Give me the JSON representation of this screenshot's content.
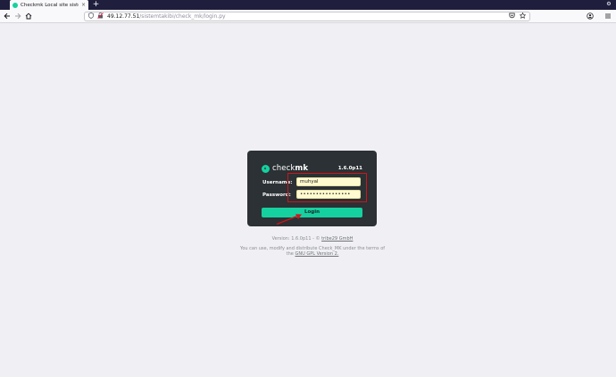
{
  "browser": {
    "tab_title": "Checkmk Local site sistemtakibi",
    "tab_close": "×",
    "new_tab": "+",
    "extension_icon": "⚙",
    "url_host": "49.12.77.51",
    "url_path": "/sistemtakibi/check_mk/login.py",
    "icons": {
      "back": "back-arrow-icon",
      "forward": "forward-arrow-icon",
      "home": "home-icon",
      "shield": "tracking-protection-shield-icon",
      "insecure_lock": "insecure-lock-icon",
      "pocket": "pocket-icon",
      "star": "bookmark-star-icon",
      "account": "account-icon",
      "menu": "hamburger-menu-icon"
    }
  },
  "login": {
    "logo_word_regular": "check",
    "logo_word_bold": "mk",
    "version": "1.6.0p11",
    "username_label": "Username:",
    "password_label": "Password:",
    "username_value": "muhyal",
    "password_value": "••••••••••••••••",
    "login_button": "Login"
  },
  "footer": {
    "version_prefix": "Version: 1.6.0p11 - ©",
    "company_link": "tribe29 GmbH",
    "license_line1": "You can use, modify and distribute Check_MK under the terms of",
    "license_line2_prefix": "the",
    "license_link": "GNU GPL Version 2."
  },
  "colors": {
    "accent": "#15d1a0",
    "login_bg": "#2b3134",
    "annotation_red": "#d0141a",
    "page_bg": "#f0f0f4"
  }
}
